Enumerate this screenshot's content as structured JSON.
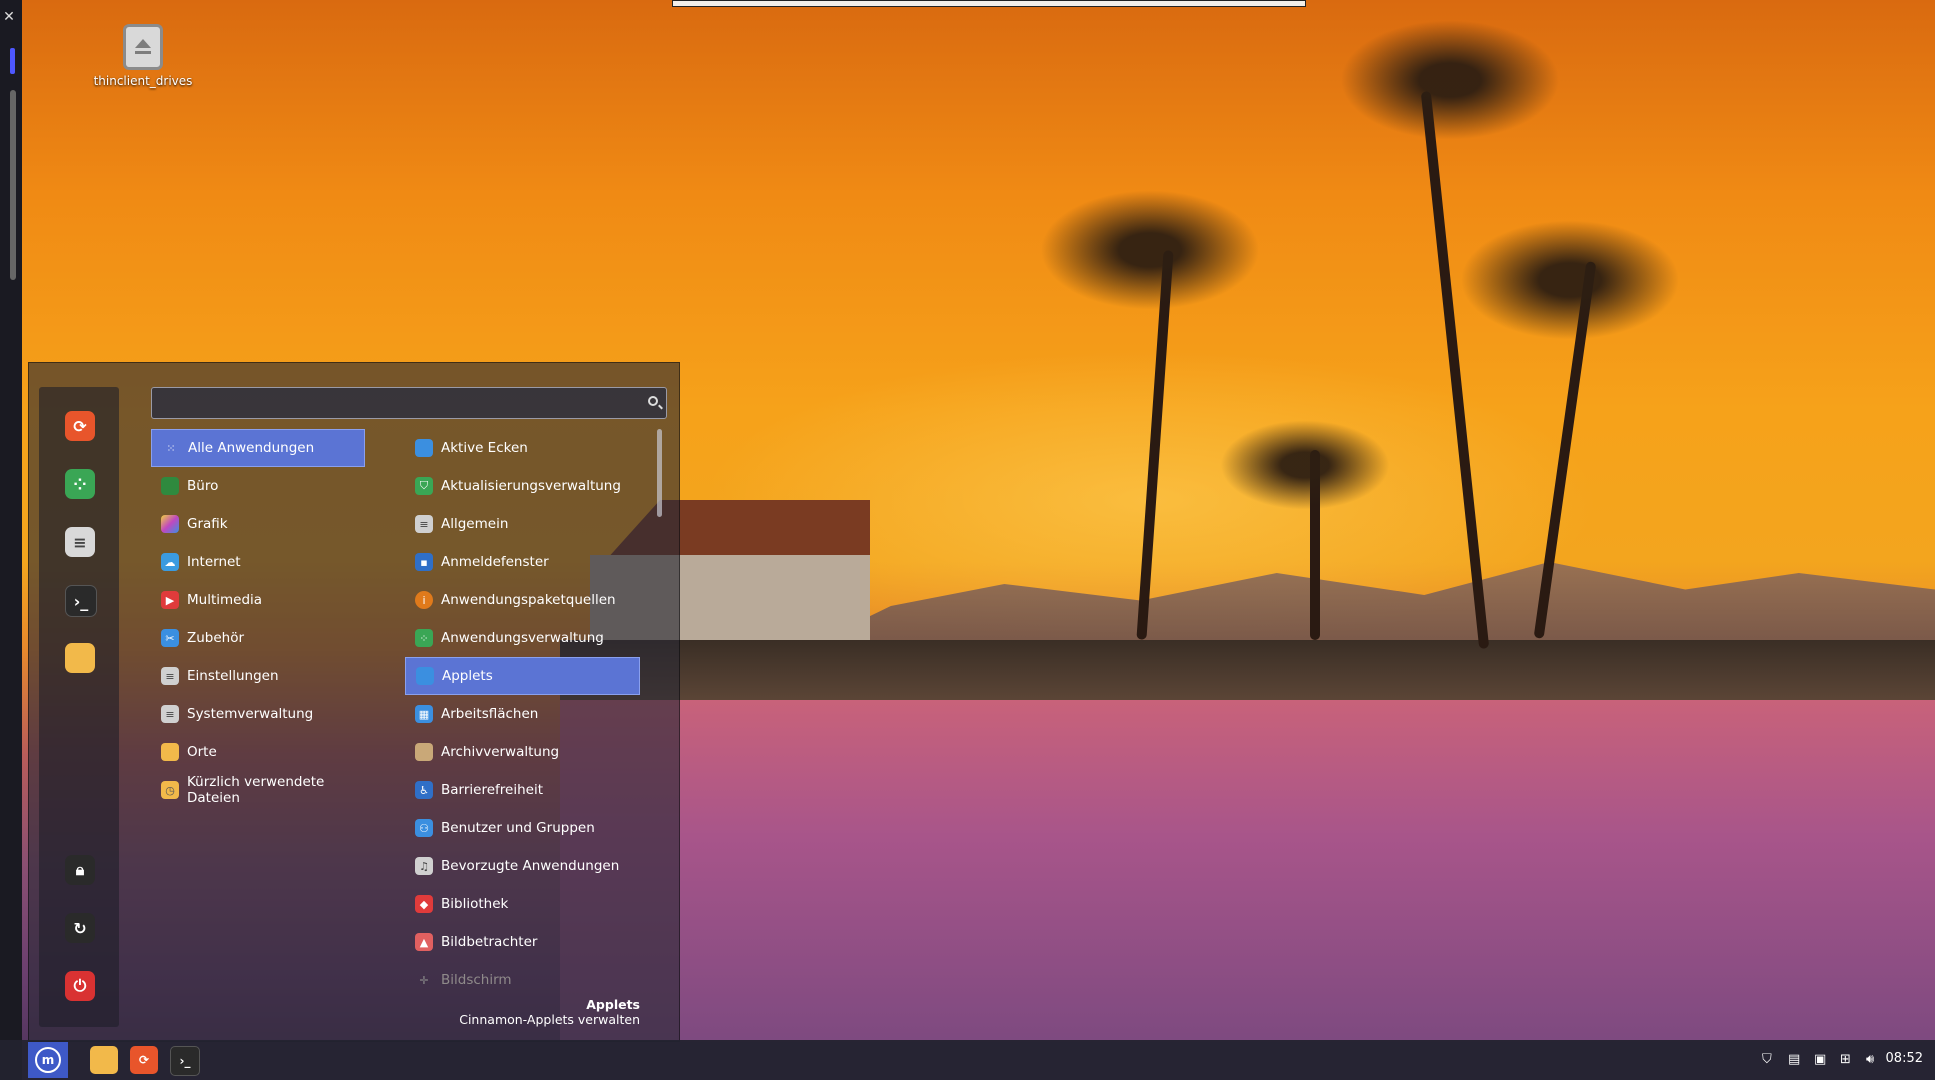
{
  "desktop": {
    "icons": [
      {
        "label": "thinclient_drives",
        "icon": "drive-icon"
      }
    ]
  },
  "menu": {
    "search": {
      "value": "",
      "placeholder": ""
    },
    "favorites": [
      {
        "name": "firefox-icon",
        "color": "#e8552b"
      },
      {
        "name": "software-manager-icon",
        "color": "#3aa655"
      },
      {
        "name": "settings-icon",
        "color": "#d8d8d8"
      },
      {
        "name": "terminal-icon",
        "color": "#2a2a2a"
      },
      {
        "name": "files-icon",
        "color": "#f2b94a"
      }
    ],
    "session": [
      {
        "name": "lock-icon"
      },
      {
        "name": "logout-icon"
      },
      {
        "name": "power-icon"
      }
    ],
    "categories": [
      {
        "label": "Alle Anwendungen",
        "icon": "grid-icon",
        "color": "#5b74d4",
        "selected": true
      },
      {
        "label": "Büro",
        "icon": "office-icon",
        "color": "#2f8a3e"
      },
      {
        "label": "Grafik",
        "icon": "graphics-icon",
        "color": "#c048c0"
      },
      {
        "label": "Internet",
        "icon": "cloud-icon",
        "color": "#3b9be0"
      },
      {
        "label": "Multimedia",
        "icon": "play-icon",
        "color": "#e03b3b"
      },
      {
        "label": "Zubehör",
        "icon": "scissors-icon",
        "color": "#3b8fe0"
      },
      {
        "label": "Einstellungen",
        "icon": "settings-icon",
        "color": "#d0d0d0"
      },
      {
        "label": "Systemverwaltung",
        "icon": "system-icon",
        "color": "#d0d0d0"
      },
      {
        "label": "Orte",
        "icon": "folder-icon",
        "color": "#f2b94a"
      },
      {
        "label": "Kürzlich verwendete Dateien",
        "icon": "recent-folder-icon",
        "color": "#f2b94a"
      }
    ],
    "apps": [
      {
        "label": "Aktive Ecken",
        "icon": "hot-corner-icon",
        "color": "#3b8fe0"
      },
      {
        "label": "Aktualisierungsverwaltung",
        "icon": "shield-icon",
        "color": "#3aa655"
      },
      {
        "label": "Allgemein",
        "icon": "general-icon",
        "color": "#d0d0d0"
      },
      {
        "label": "Anmeldefenster",
        "icon": "login-window-icon",
        "color": "#2f6fc7"
      },
      {
        "label": "Anwendungspaketquellen",
        "icon": "info-icon",
        "color": "#e07a1b"
      },
      {
        "label": "Anwendungsverwaltung",
        "icon": "software-manager-icon",
        "color": "#3aa655"
      },
      {
        "label": "Applets",
        "icon": "applets-icon",
        "color": "#3b8fe0",
        "selected": true
      },
      {
        "label": "Arbeitsflächen",
        "icon": "workspaces-icon",
        "color": "#3b8fe0"
      },
      {
        "label": "Archivverwaltung",
        "icon": "archive-icon",
        "color": "#c9a878"
      },
      {
        "label": "Barrierefreiheit",
        "icon": "accessibility-icon",
        "color": "#2f6fc7"
      },
      {
        "label": "Benutzer und Gruppen",
        "icon": "users-icon",
        "color": "#3b8fe0"
      },
      {
        "label": "Bevorzugte Anwendungen",
        "icon": "preferred-apps-icon",
        "color": "#d0d0d0"
      },
      {
        "label": "Bibliothek",
        "icon": "library-icon",
        "color": "#e03b3b"
      },
      {
        "label": "Bildbetrachter",
        "icon": "image-viewer-icon",
        "color": "#e06060"
      },
      {
        "label": "Bildschirm",
        "icon": "display-icon",
        "color": "#777777",
        "dim": true
      }
    ],
    "description": {
      "title": "Applets",
      "text": "Cinnamon-Applets verwalten"
    }
  },
  "taskbar": {
    "start_icon": "mint-logo-icon",
    "launchers": [
      "files-icon",
      "firefox-icon",
      "terminal-icon"
    ],
    "tray": [
      "shield-update-icon",
      "printer-icon",
      "clipboard-icon",
      "network-icon",
      "volume-icon"
    ],
    "clock": "08:52"
  },
  "colors": {
    "accent": "#5b74d4",
    "panel": "#23232f"
  }
}
